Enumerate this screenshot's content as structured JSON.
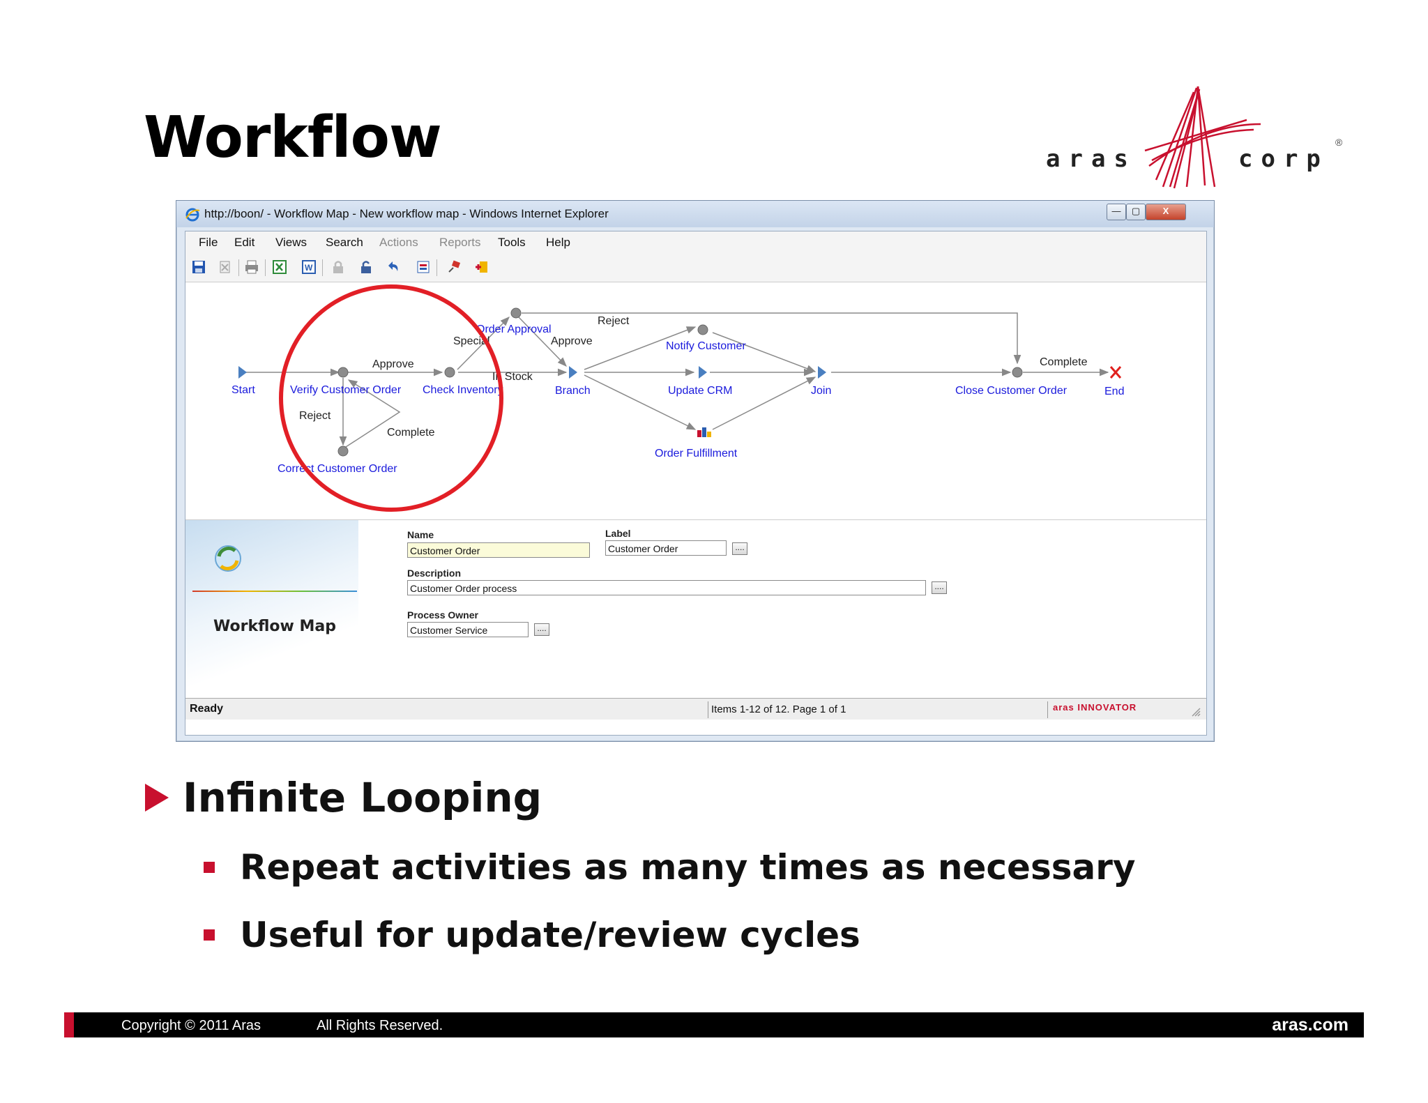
{
  "slide": {
    "title": "Workflow",
    "logo_left": "aras",
    "logo_right": "corp",
    "logo_reg": "®"
  },
  "window": {
    "title": "http://boon/ - Workflow Map - New workflow map - Windows Internet Explorer",
    "buttons": {
      "minimize": "—",
      "maximize": "▢",
      "close": "X"
    }
  },
  "menu": [
    "File",
    "Edit",
    "Views",
    "Search",
    "Actions",
    "Reports",
    "Tools",
    "Help"
  ],
  "toolbar_icons": [
    "save-icon",
    "delete-icon",
    "print-icon",
    "excel-icon",
    "word-icon",
    "lock-icon",
    "unlock-icon",
    "undo-icon",
    "properties-icon",
    "pin-icon",
    "add-icon"
  ],
  "workflow": {
    "nodes": {
      "start": "Start",
      "verify": "Verify Customer Order",
      "check": "Check Inventory",
      "approval": "Order Approval",
      "branch": "Branch",
      "notify": "Notify Customer",
      "crm": "Update CRM",
      "fulfillment": "Order Fulfillment",
      "join": "Join",
      "close": "Close Customer Order",
      "end": "End",
      "correct": "Correct Customer Order"
    },
    "edges": {
      "approve1": "Approve",
      "reject1": "Reject",
      "complete1": "Complete",
      "special": "Special",
      "in_stock": "In Stock",
      "approve2": "Approve",
      "reject2": "Reject",
      "complete2": "Complete"
    },
    "highlight_color": "#e21f26",
    "node_label_color": "#1a1adc"
  },
  "form": {
    "banner_title": "Workflow Map",
    "name_label": "Name",
    "name_value": "Customer Order",
    "label_label": "Label",
    "label_value": "Customer Order",
    "description_label": "Description",
    "description_value": "Customer Order process",
    "owner_label": "Process Owner",
    "owner_value": "Customer Service",
    "ellipsis": "...."
  },
  "status": {
    "ready": "Ready",
    "items": "Items 1-12 of 12. Page 1 of 1",
    "brand": "aras INNOVATOR"
  },
  "bullets": {
    "main": "Infinite Looping",
    "subs": [
      "Repeat activities as many times as necessary",
      "Useful for update/review cycles"
    ]
  },
  "footer": {
    "copyright": "Copyright © 2011 Aras",
    "rights": "All Rights Reserved.",
    "site": "aras.com"
  }
}
